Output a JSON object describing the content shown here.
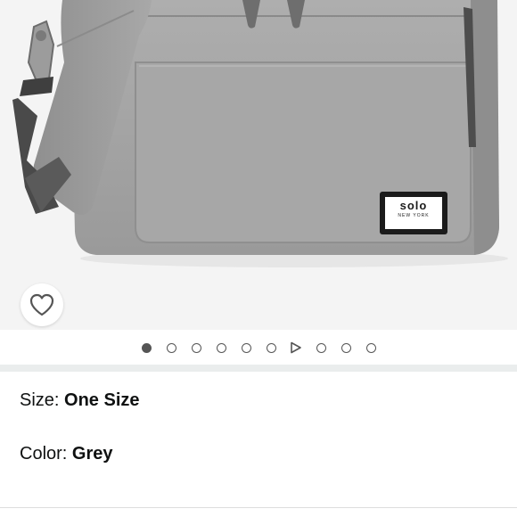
{
  "product_image": {
    "logo_text": "solo",
    "logo_subtext": "NEW YORK",
    "background_color": "#f4f4f4"
  },
  "wishlist": {
    "icon": "heart-outline-icon"
  },
  "pager": {
    "count": 10,
    "active_index": 0,
    "video_index": 6
  },
  "options": {
    "size": {
      "label": "Size: ",
      "value": "One Size"
    },
    "color": {
      "label": "Color: ",
      "value": "Grey"
    }
  },
  "colors": {
    "text": "#0f1111",
    "dot": "#555555",
    "divider": "#eaeded"
  }
}
